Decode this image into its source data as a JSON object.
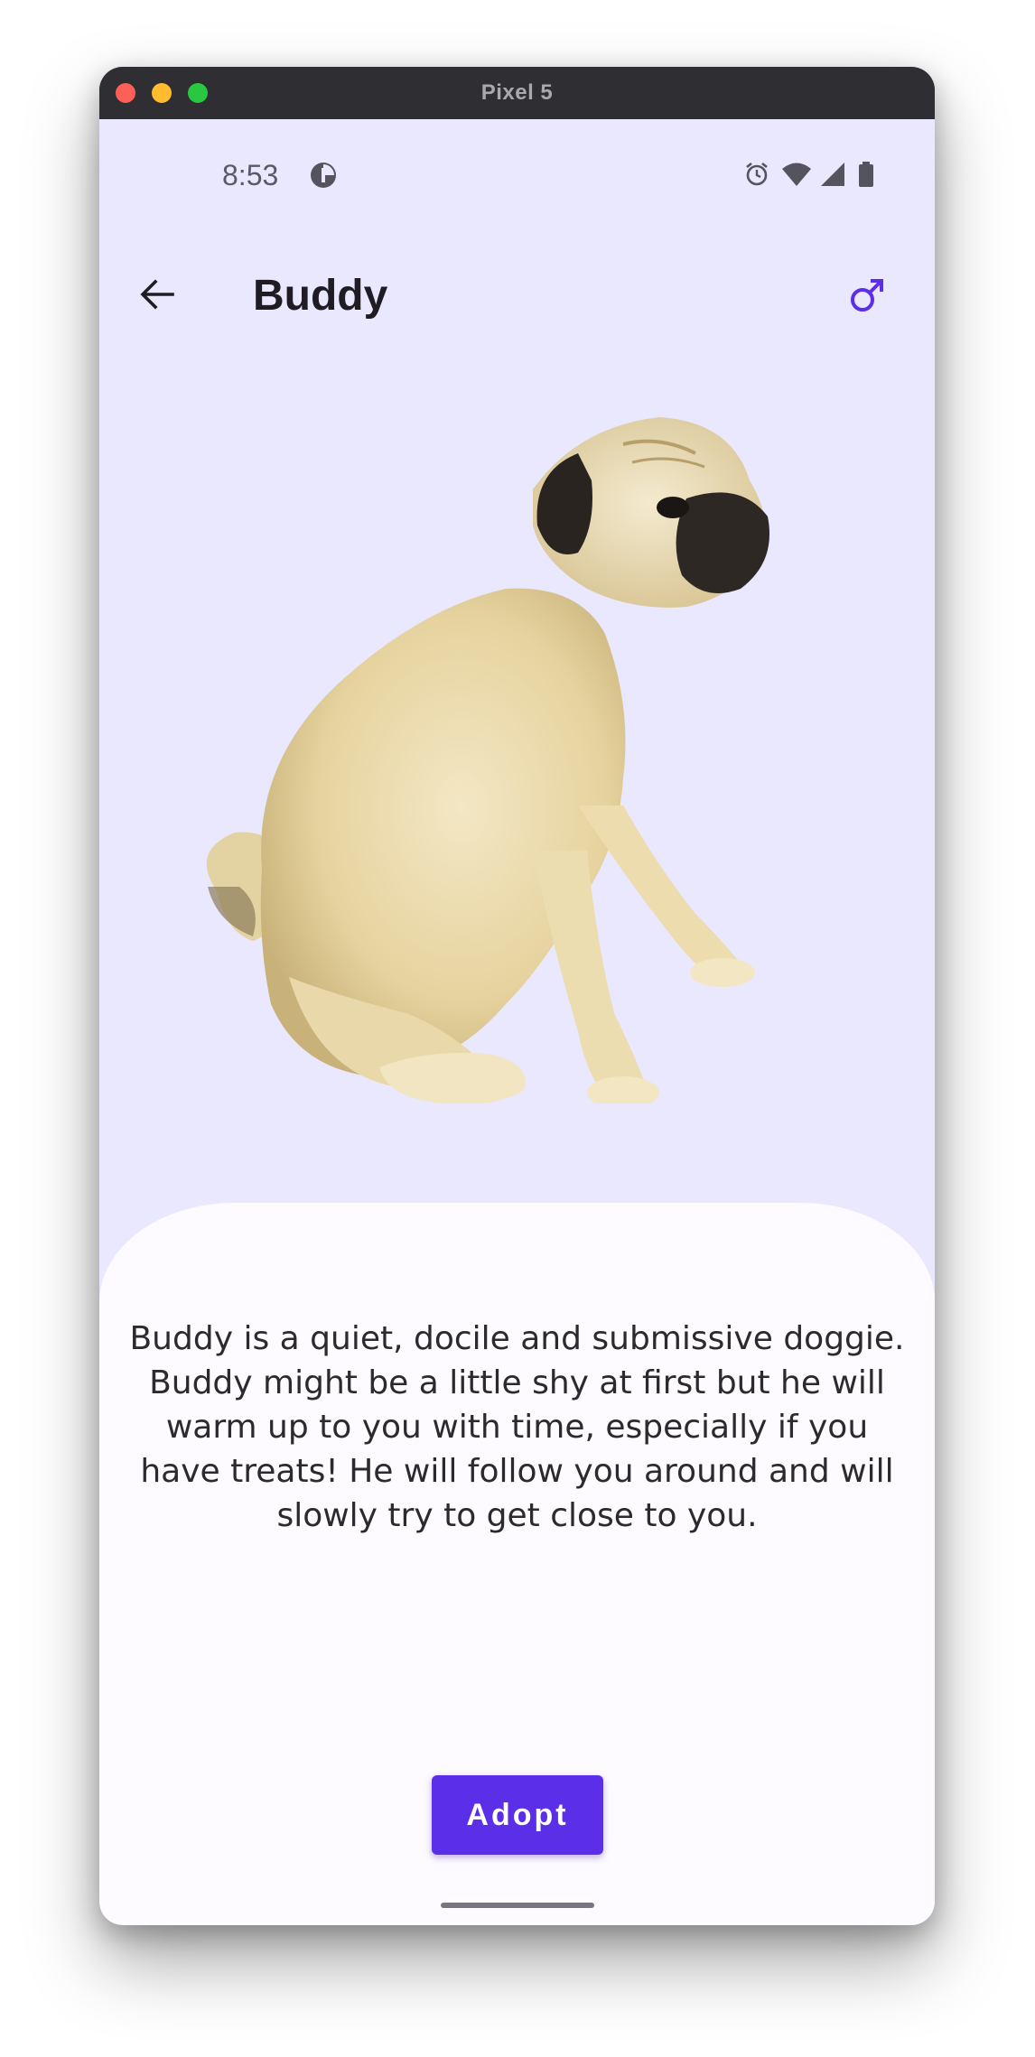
{
  "window": {
    "title": "Pixel 5"
  },
  "status_bar": {
    "time": "8:53",
    "icons": [
      "data-saver-icon",
      "alarm-icon",
      "wifi-icon",
      "cell-signal-icon",
      "battery-icon"
    ]
  },
  "app_bar": {
    "title": "Buddy",
    "back_icon": "arrow-back-icon",
    "gender_icon": "male-icon",
    "accent_color": "#5b2ee8"
  },
  "pet": {
    "image": "pug-photo",
    "description": "Buddy is a quiet, docile and submissive doggie. Buddy might be a little shy at first but he will warm up to you with time, especially if you have treats! He will follow you around and will slowly try to get close to you."
  },
  "actions": {
    "adopt_label": "Adopt"
  },
  "colors": {
    "screen_background": "#e9e8ff",
    "sheet_background": "#fdfbff",
    "button_background": "#5b2ee8"
  }
}
